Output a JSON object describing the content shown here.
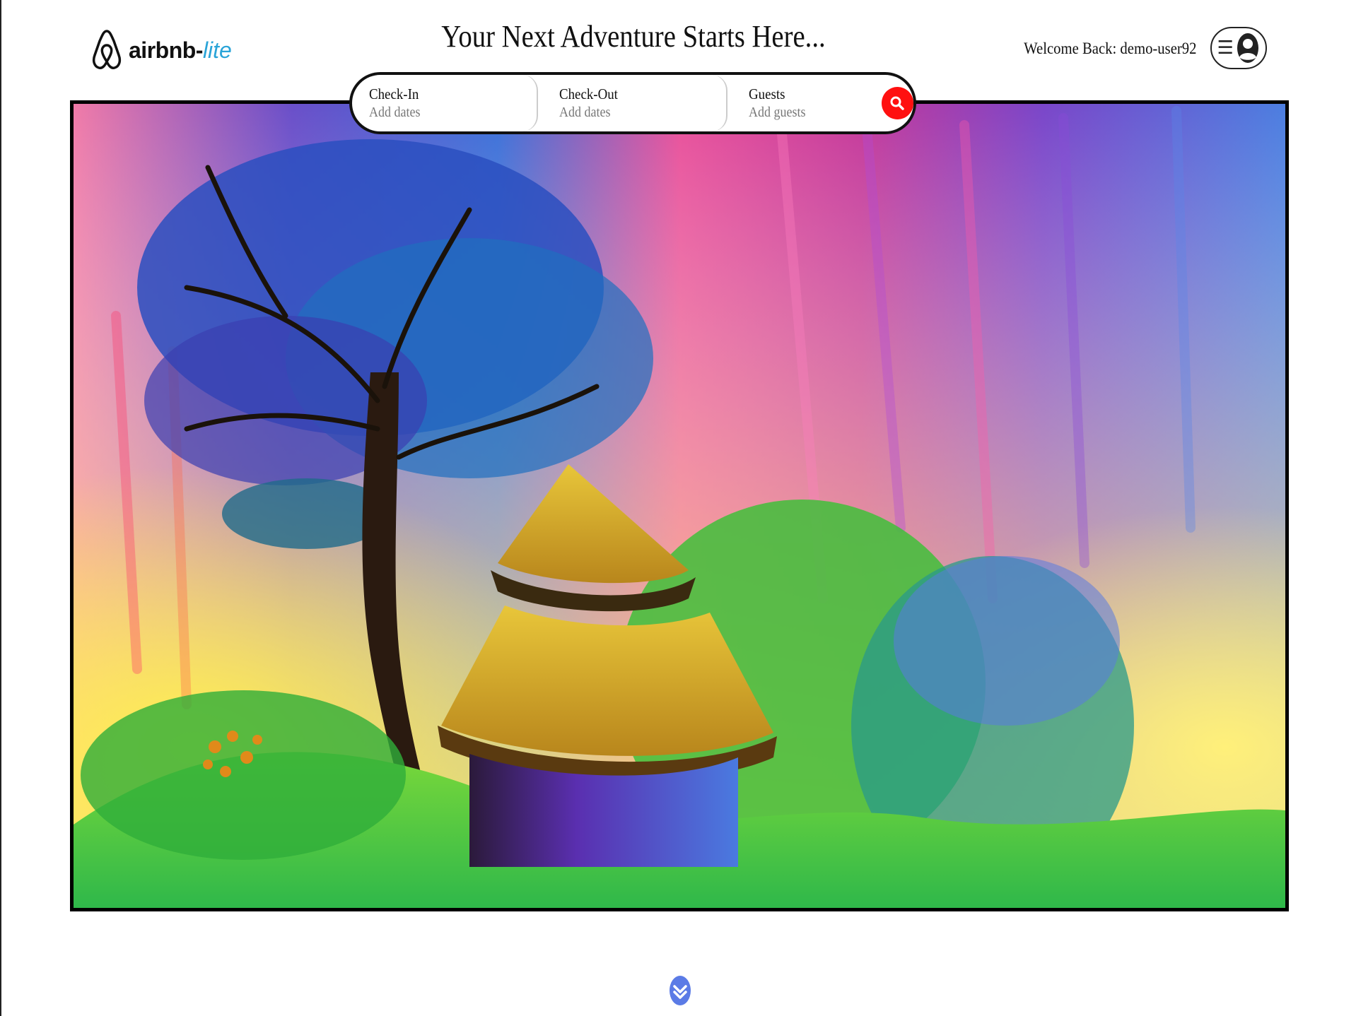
{
  "header": {
    "brand": "airbnb-",
    "brand_suffix": "lite",
    "headline": "Your Next Adventure Starts Here...",
    "welcome": "Welcome Back: demo-user92"
  },
  "search": {
    "checkin_label": "Check-In",
    "checkin_placeholder": "Add dates",
    "checkout_label": "Check-Out",
    "checkout_placeholder": "Add dates",
    "guests_label": "Guests",
    "guests_placeholder": "Add guests"
  },
  "icons": {
    "logo": "airbnb-logo-icon",
    "menu": "hamburger-icon",
    "avatar": "user-avatar-icon",
    "search": "search-icon",
    "scroll": "chevron-down-icon"
  },
  "colors": {
    "brand_accent": "#2aa4d8",
    "search_button": "#ff1010",
    "scroll_button": "#5b7be6"
  }
}
